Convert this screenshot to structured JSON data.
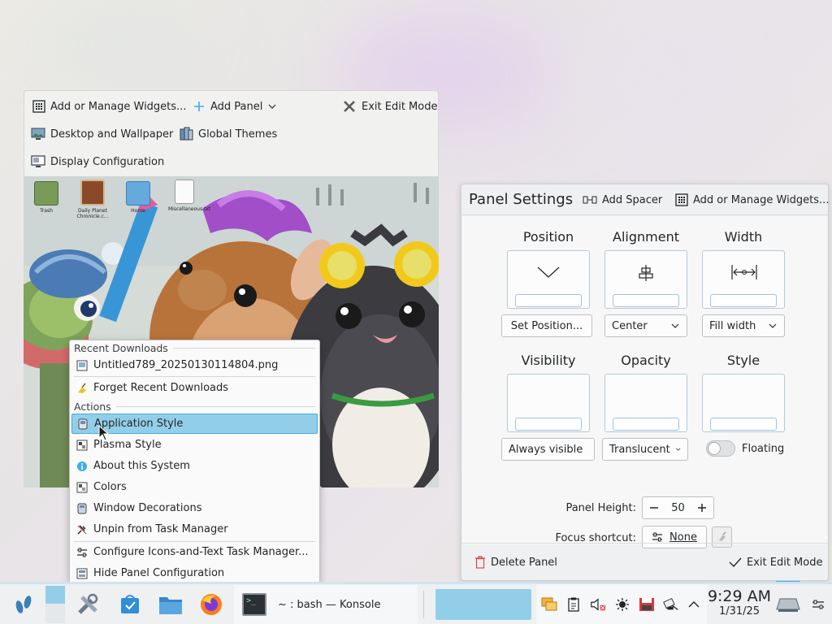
{
  "toolbar": {
    "add_widgets": "Add or Manage Widgets...",
    "add_panel": "Add Panel",
    "exit_edit": "Exit Edit Mode",
    "desktop_wallpaper": "Desktop and Wallpaper",
    "global_themes": "Global Themes",
    "display_config": "Display Configuration"
  },
  "desktop_icons": [
    {
      "label": "Trash",
      "icon": "trash-icon"
    },
    {
      "label": "Daily Planet Chronicle.c...",
      "icon": "image-file-icon"
    },
    {
      "label": "Home",
      "icon": "home-folder-icon"
    },
    {
      "label": "Miscellaneous.txt",
      "icon": "text-file-icon"
    }
  ],
  "context_menu": {
    "recent_header": "Recent Downloads",
    "recent_file": "Untitled789_20250130114804.png",
    "forget_recent": "Forget Recent Downloads",
    "actions_header": "Actions",
    "items": [
      {
        "label": "Application Style",
        "icon": "application-style-icon",
        "highlighted": true
      },
      {
        "label": "Plasma Style",
        "icon": "plasma-style-icon"
      },
      {
        "label": "About this System",
        "icon": "info-icon"
      },
      {
        "label": "Colors",
        "icon": "colors-icon"
      },
      {
        "label": "Window Decorations",
        "icon": "window-decorations-icon"
      },
      {
        "label": "Unpin from Task Manager",
        "icon": "unpin-icon"
      }
    ],
    "configure": "Configure Icons-and-Text Task Manager...",
    "hide_panel": "Hide Panel Configuration"
  },
  "panel_settings": {
    "title": "Panel Settings",
    "add_spacer": "Add Spacer",
    "add_widgets": "Add or Manage Widgets...",
    "position_label": "Position",
    "alignment_label": "Alignment",
    "width_label": "Width",
    "set_position": "Set Position...",
    "alignment_value": "Center",
    "width_value": "Fill width",
    "visibility_label": "Visibility",
    "opacity_label": "Opacity",
    "style_label": "Style",
    "visibility_value": "Always visible",
    "opacity_value": "Translucent",
    "floating_label": "Floating",
    "floating_on": false,
    "panel_height_label": "Panel Height:",
    "panel_height_value": "50",
    "focus_shortcut_label": "Focus shortcut:",
    "focus_shortcut_value": "None",
    "delete_panel": "Delete Panel",
    "exit_edit": "Exit Edit Mode"
  },
  "taskbar": {
    "konsole_title": "~ : bash — Konsole",
    "time": "9:29 AM",
    "date": "1/31/25"
  },
  "colors": {
    "accent": "#3daee9",
    "highlight": "#93cee9",
    "delete_red": "#da4453"
  }
}
